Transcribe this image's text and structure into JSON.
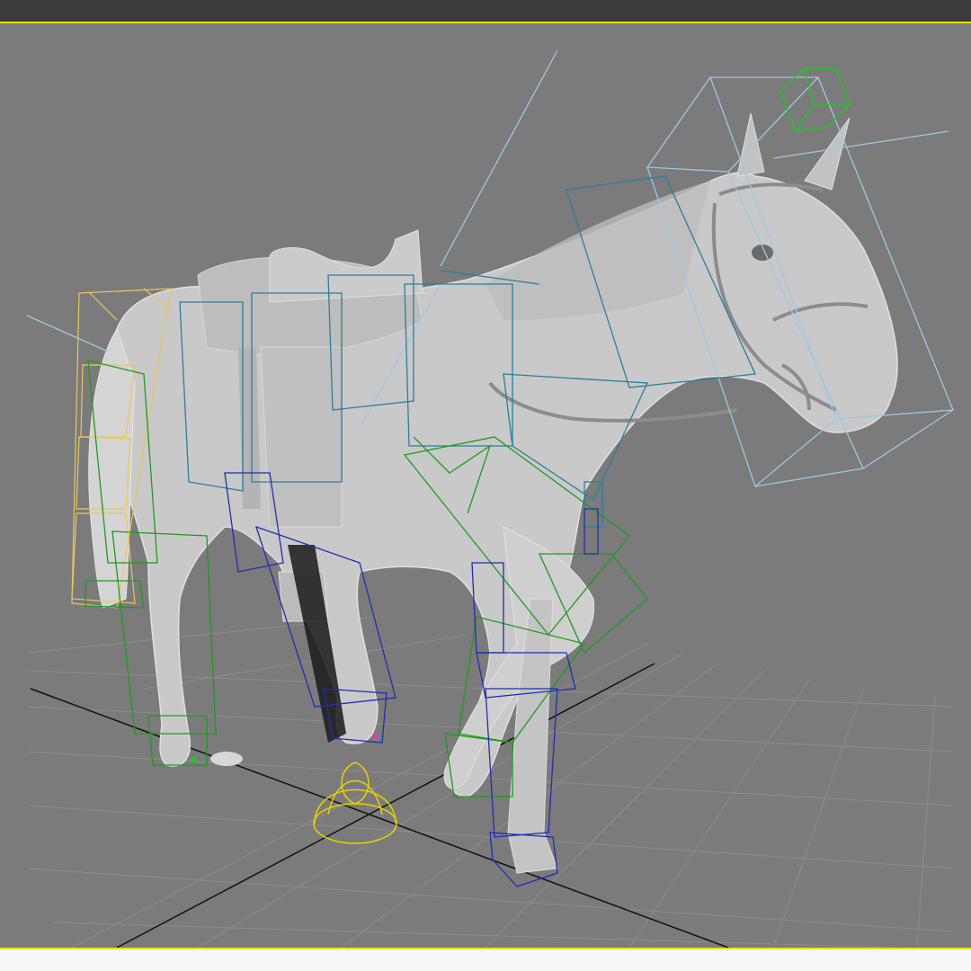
{
  "app": {
    "viewport_label": "",
    "active_border_color": "#e6e600",
    "viewport_background": "#7b7b7b",
    "title_bar_color": "#3b3b3b"
  },
  "scene": {
    "model": "horse-with-saddle-and-bridle",
    "grid": "on",
    "world_axes": "on",
    "rig_colors": {
      "front_leg_rig": "#1f9a1f",
      "hind_leg_rig": "#1f2fb0",
      "spine_rig": "#2a7f9c",
      "head_neck_rig": "#9ec8e0",
      "tail_rig": "#e8c860",
      "control_helper": "#e6d200"
    }
  }
}
